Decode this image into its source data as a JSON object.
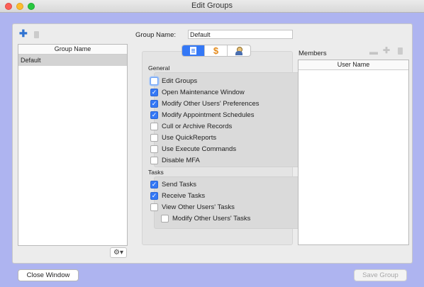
{
  "window": {
    "title": "Edit Groups"
  },
  "groups_panel": {
    "header": "Group Name",
    "rows": [
      "Default"
    ],
    "add_icon": "plus-icon",
    "delete_icon": "trash-icon",
    "gear_icon": "gear-icon",
    "gear_menu_glyph": "⚙▾"
  },
  "group_name": {
    "label": "Group Name:",
    "value": "Default"
  },
  "tabs": [
    {
      "icon": "document-icon",
      "active": true
    },
    {
      "icon": "dollar-icon",
      "glyph": "$",
      "active": false
    },
    {
      "icon": "person-icon",
      "active": false
    }
  ],
  "general": {
    "title": "General",
    "items": [
      {
        "label": "Edit Groups",
        "checked": false
      },
      {
        "label": "Open Maintenance Window",
        "checked": true
      },
      {
        "label": "Modify Other Users' Preferences",
        "checked": true
      },
      {
        "label": "Modify Appointment Schedules",
        "checked": true
      },
      {
        "label": "Cull or Archive Records",
        "checked": false
      },
      {
        "label": "Use QuickReports",
        "checked": false
      },
      {
        "label": "Use Execute Commands",
        "checked": false
      },
      {
        "label": "Disable MFA",
        "checked": false
      }
    ]
  },
  "tasks": {
    "title": "Tasks",
    "items": [
      {
        "label": "Send Tasks",
        "checked": true
      },
      {
        "label": "Receive Tasks",
        "checked": true
      },
      {
        "label": "View Other Users' Tasks",
        "checked": false
      },
      {
        "label": "Modify Other Users' Tasks",
        "checked": false
      }
    ]
  },
  "members": {
    "title": "Members",
    "header": "User Name",
    "rows": []
  },
  "buttons": {
    "close": "Close Window",
    "save": "Save Group"
  },
  "colors": {
    "accent": "#3478f6",
    "background": "#aeb4f0"
  }
}
